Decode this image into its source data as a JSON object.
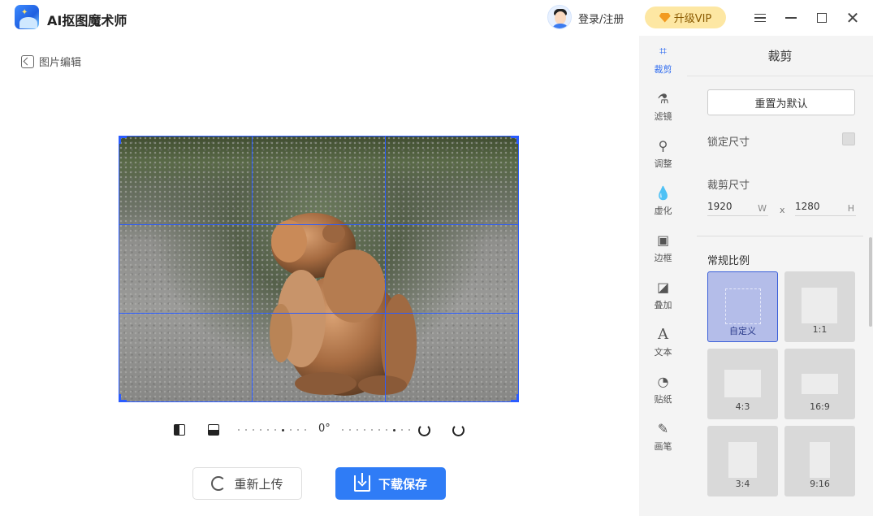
{
  "app": {
    "title": "AI抠图魔术师",
    "login_label": "登录/注册",
    "vip_label": "升级VIP",
    "vip_color": "#fde7a3",
    "accent_color": "#2f7cf6"
  },
  "breadcrumb": {
    "label": "图片编辑",
    "icon": "home-icon"
  },
  "editor": {
    "angle": "0°",
    "reupload_label": "重新上传",
    "save_label": "下载保存"
  },
  "rail": {
    "items": [
      {
        "label": "裁剪",
        "icon": "crop-icon",
        "active": true
      },
      {
        "label": "滤镜",
        "icon": "filter-icon"
      },
      {
        "label": "调整",
        "icon": "adjust-icon"
      },
      {
        "label": "虚化",
        "icon": "blur-icon"
      },
      {
        "label": "边框",
        "icon": "border-icon"
      },
      {
        "label": "叠加",
        "icon": "overlay-icon"
      },
      {
        "label": "文本",
        "icon": "text-icon"
      },
      {
        "label": "贴纸",
        "icon": "sticker-icon"
      },
      {
        "label": "画笔",
        "icon": "brush-icon"
      }
    ]
  },
  "panel": {
    "title": "裁剪",
    "reset_label": "重置为默认",
    "lock_label": "锁定尺寸",
    "size_label": "裁剪尺寸",
    "width_value": "1920",
    "width_unit": "W",
    "height_value": "1280",
    "height_unit": "H",
    "separator": "x",
    "ratio_title": "常规比例",
    "ratios": [
      {
        "label": "自定义",
        "selected": true
      },
      {
        "label": "1:1"
      },
      {
        "label": "4:3"
      },
      {
        "label": "16:9"
      },
      {
        "label": "3:4"
      },
      {
        "label": "9:16"
      }
    ]
  }
}
